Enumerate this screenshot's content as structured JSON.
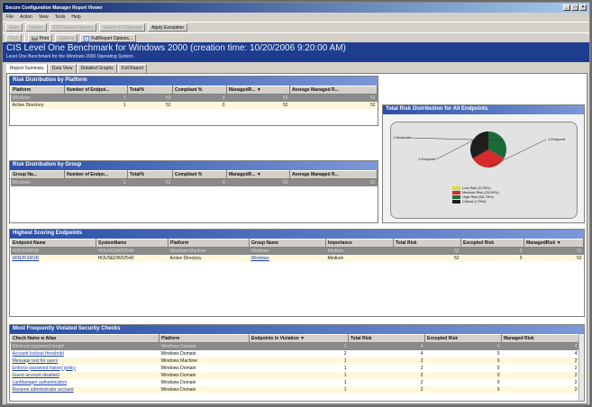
{
  "window": {
    "title": "Secure Configuration Manager Report Viewer",
    "controls": [
      "_",
      "□",
      "×"
    ]
  },
  "menu": [
    "File",
    "Action",
    "View",
    "Tools",
    "Help"
  ],
  "toolbar": {
    "items": [
      {
        "label": "Save",
        "enabled": false
      },
      {
        "label": "Viewer",
        "enabled": false
      },
      {
        "label": "CSV Export Options",
        "enabled": false
      },
      {
        "label": "Export to Clipboard",
        "enabled": false
      },
      {
        "label": "Apply Exception",
        "enabled": true
      },
      {
        "label": "Find",
        "enabled": false
      },
      {
        "label": "Print",
        "enabled": true
      },
      {
        "label": "Options",
        "enabled": false
      },
      {
        "label": "FullReport Options...",
        "enabled": true
      }
    ]
  },
  "header": {
    "title": "CIS Level One Benchmark for Windows 2000 (creation time: 10/20/2006 9:20:00 AM)",
    "subtitle": "Level One Benchmark for the Windows 2000 Operating System."
  },
  "tabs": [
    "Report Summary",
    "Data View",
    "Detailed Graphs",
    "Full Report"
  ],
  "active_tab": 0,
  "platform_panel": {
    "title": "Risk Distribution by Platform",
    "columns": [
      "Platform",
      "Number of Endpoi...",
      "Total%",
      "Compliant %",
      "ManagedR... ▼",
      "Average Managed R..."
    ],
    "rows": [
      [
        "Windows",
        "1",
        "52",
        "0",
        "52",
        "52"
      ],
      [
        "Active Directory",
        "1",
        "52",
        "0",
        "52",
        "52"
      ]
    ]
  },
  "group_panel": {
    "title": "Risk Distribution by Group",
    "columns": [
      "Group Na...",
      "Number of Endpo...",
      "Total%",
      "Compliant %",
      "ManagedR... ▼",
      "Average Managed R..."
    ],
    "rows": [
      [
        "Windows",
        "1",
        "52",
        "0",
        "52",
        "52"
      ]
    ]
  },
  "chart_panel": {
    "title": "Total Risk Distribution for All Endpoints"
  },
  "chart_data": {
    "type": "pie",
    "slices": [
      {
        "label": "1 Endpoint",
        "value": 1,
        "color": "#1a6b3a"
      },
      {
        "label": "1 Endpoint",
        "value": 1,
        "color": "#d52b2b"
      },
      {
        "label": "1 Endpoint",
        "value": 1,
        "color": "#1e1e1e"
      }
    ],
    "legend": [
      {
        "label": "Low Risk (0-25%)",
        "color": "#e0dc2e"
      },
      {
        "label": "Medium Risk (25-50%)",
        "color": "#d52b2b"
      },
      {
        "label": "High Risk (50-75%)",
        "color": "#1a6b3a"
      },
      {
        "label": "Critical (>75%)",
        "color": "#1e1e1e"
      }
    ]
  },
  "endpoints_panel": {
    "title": "Highest Scoring Endpoints",
    "columns": [
      "Endpoint Name",
      "SystemName",
      "Platform",
      "Group Name",
      "Importance",
      "Total Risk",
      "Excepted Risk",
      "ManagedRisk ▼"
    ],
    "rows": [
      [
        "WIN2KSRVR",
        "HOUSEDW02540",
        "Windows Machine",
        "Windows",
        "Medium",
        "52",
        "0",
        "52"
      ],
      [
        "WIN2KSRVR",
        "HOUSEDW02540",
        "Active Directory",
        "Windows",
        "Medium",
        "52",
        "0",
        "52"
      ]
    ]
  },
  "checks_panel": {
    "title": "Most Frequently Violated Security Checks",
    "columns": [
      "Check Name w Alias",
      "Platform",
      "Endpoints in Violation ▼",
      "Total Risk",
      "Excepted Risk",
      "Managed Risk"
    ],
    "rows": [
      [
        "Minimum password length",
        "Windows Domain",
        "2",
        "4",
        "0",
        "4"
      ],
      [
        "Account lockout threshold",
        "Windows Domain",
        "2",
        "4",
        "0",
        "4"
      ],
      [
        "Message text for users",
        "Windows Machine",
        "1",
        "2",
        "0",
        "2"
      ],
      [
        "Enforce password history policy",
        "Windows Domain",
        "1",
        "2",
        "0",
        "2"
      ],
      [
        "Guest account disabled",
        "Windows Domain",
        "1",
        "2",
        "0",
        "2"
      ],
      [
        "LanManager authentication",
        "Windows Domain",
        "1",
        "2",
        "0",
        "2"
      ],
      [
        "Rename administrator account",
        "Windows Domain",
        "1",
        "2",
        "0",
        "2"
      ]
    ]
  }
}
